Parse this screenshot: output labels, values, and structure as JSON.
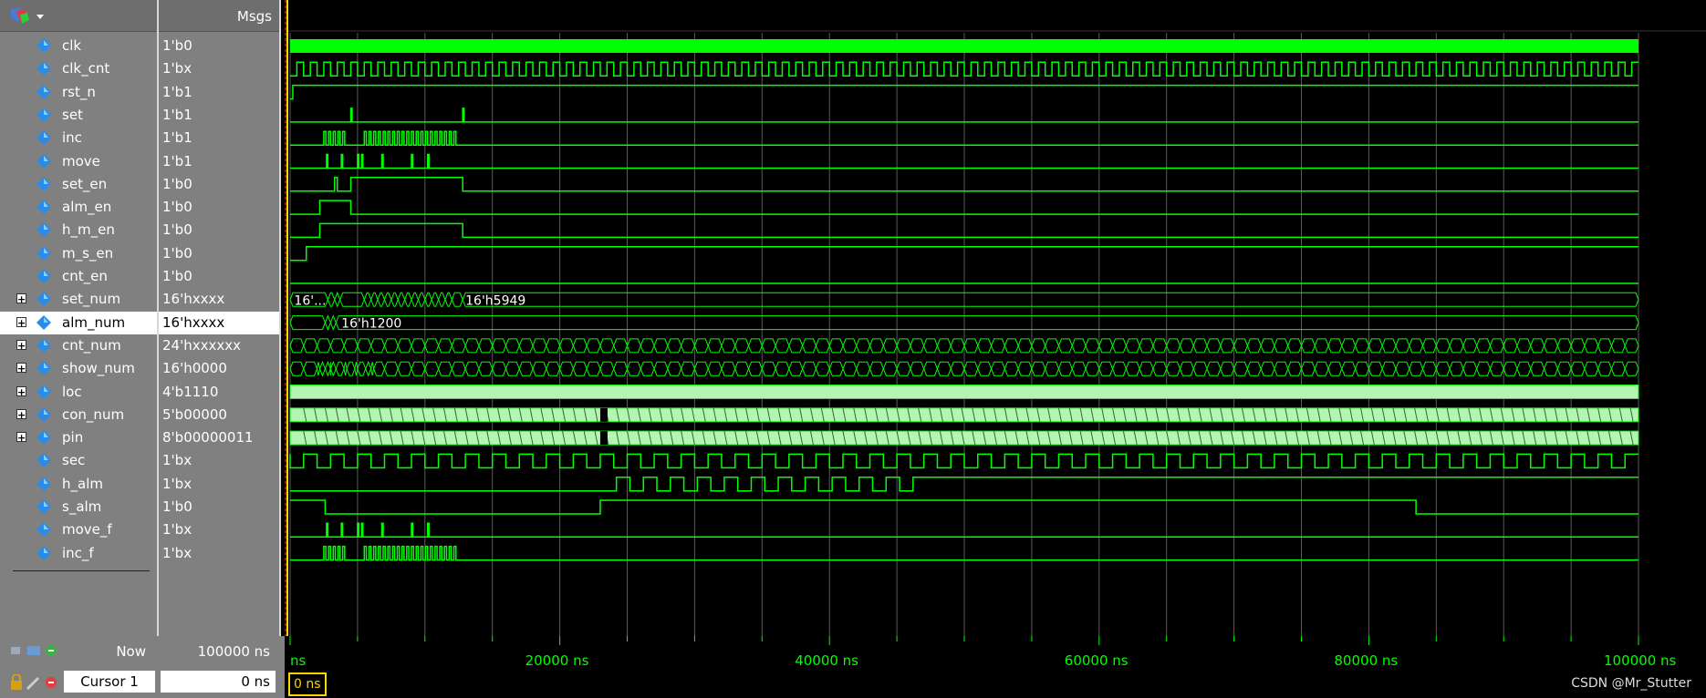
{
  "header": {
    "msgs_label": "Msgs"
  },
  "signals": [
    {
      "name": "clk",
      "value": "1'b0",
      "expandable": false
    },
    {
      "name": "clk_cnt",
      "value": "1'bx",
      "expandable": false
    },
    {
      "name": "rst_n",
      "value": "1'b1",
      "expandable": false
    },
    {
      "name": "set",
      "value": "1'b1",
      "expandable": false
    },
    {
      "name": "inc",
      "value": "1'b1",
      "expandable": false
    },
    {
      "name": "move",
      "value": "1'b1",
      "expandable": false
    },
    {
      "name": "set_en",
      "value": "1'b0",
      "expandable": false
    },
    {
      "name": "alm_en",
      "value": "1'b0",
      "expandable": false
    },
    {
      "name": "h_m_en",
      "value": "1'b0",
      "expandable": false
    },
    {
      "name": "m_s_en",
      "value": "1'b0",
      "expandable": false
    },
    {
      "name": "cnt_en",
      "value": "1'b0",
      "expandable": false
    },
    {
      "name": "set_num",
      "value": "16'hxxxx",
      "expandable": true
    },
    {
      "name": "alm_num",
      "value": "16'hxxxx",
      "expandable": true,
      "selected": true
    },
    {
      "name": "cnt_num",
      "value": "24'hxxxxxx",
      "expandable": true
    },
    {
      "name": "show_num",
      "value": "16'h0000",
      "expandable": true
    },
    {
      "name": "loc",
      "value": "4'b1110",
      "expandable": true
    },
    {
      "name": "con_num",
      "value": "5'b00000",
      "expandable": true
    },
    {
      "name": "pin",
      "value": "8'b00000011",
      "expandable": true
    },
    {
      "name": "sec",
      "value": "1'bx",
      "expandable": false
    },
    {
      "name": "h_alm",
      "value": "1'bx",
      "expandable": false
    },
    {
      "name": "s_alm",
      "value": "1'b0",
      "expandable": false
    },
    {
      "name": "move_f",
      "value": "1'bx",
      "expandable": false
    },
    {
      "name": "inc_f",
      "value": "1'bx",
      "expandable": false
    }
  ],
  "wave_labels": {
    "set_num_first": "16'...",
    "set_num_last": "16'h5949",
    "alm_num_last": "16'h1200"
  },
  "status": {
    "now_label": "Now",
    "now_value": "100000 ns",
    "cursor_label": "Cursor 1",
    "cursor_value": "0 ns",
    "cursor_marker": "0 ns"
  },
  "timeline": {
    "labels": [
      "ns",
      "20000 ns",
      "40000 ns",
      "60000 ns",
      "80000 ns",
      "100000 ns"
    ]
  },
  "watermark": "CSDN @Mr_Stutter",
  "colors": {
    "wave": "#00ff00",
    "bus_fill": "#b4f5b4",
    "grid": "#5a5a5a"
  }
}
